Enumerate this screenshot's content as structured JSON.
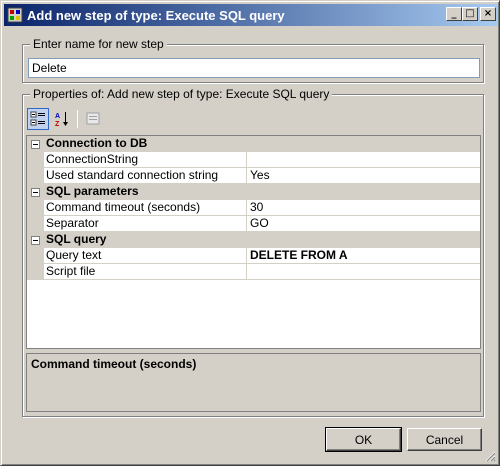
{
  "window": {
    "title": "Add new step of type: Execute SQL query",
    "minimize": "_",
    "maximize": "□",
    "close": "×"
  },
  "name_group": {
    "label": "Enter name for new step",
    "value": "Delete"
  },
  "properties_group": {
    "label": "Properties of: Add new step of type: Execute SQL query",
    "toolbar": {
      "categorized_icon": "categorized-icon",
      "alphabetical_icon": "alphabetical-icon",
      "property_pages_icon": "property-pages-icon"
    },
    "categories": [
      {
        "name": "Connection to DB",
        "properties": [
          {
            "name": "ConnectionString",
            "value": ""
          },
          {
            "name": "Used standard connection string",
            "value": "Yes"
          }
        ]
      },
      {
        "name": "SQL parameters",
        "properties": [
          {
            "name": "Command timeout (seconds)",
            "value": "30"
          },
          {
            "name": "Separator",
            "value": "GO"
          }
        ]
      },
      {
        "name": "SQL query",
        "properties": [
          {
            "name": "Query text",
            "value": "DELETE FROM A"
          },
          {
            "name": "Script file",
            "value": ""
          }
        ]
      }
    ],
    "description": {
      "title": "Command timeout (seconds)"
    }
  },
  "buttons": {
    "ok": "OK",
    "cancel": "Cancel"
  },
  "colors": {
    "title_start": "#0a246a",
    "title_end": "#a6caf0",
    "face": "#d4d0c8"
  }
}
